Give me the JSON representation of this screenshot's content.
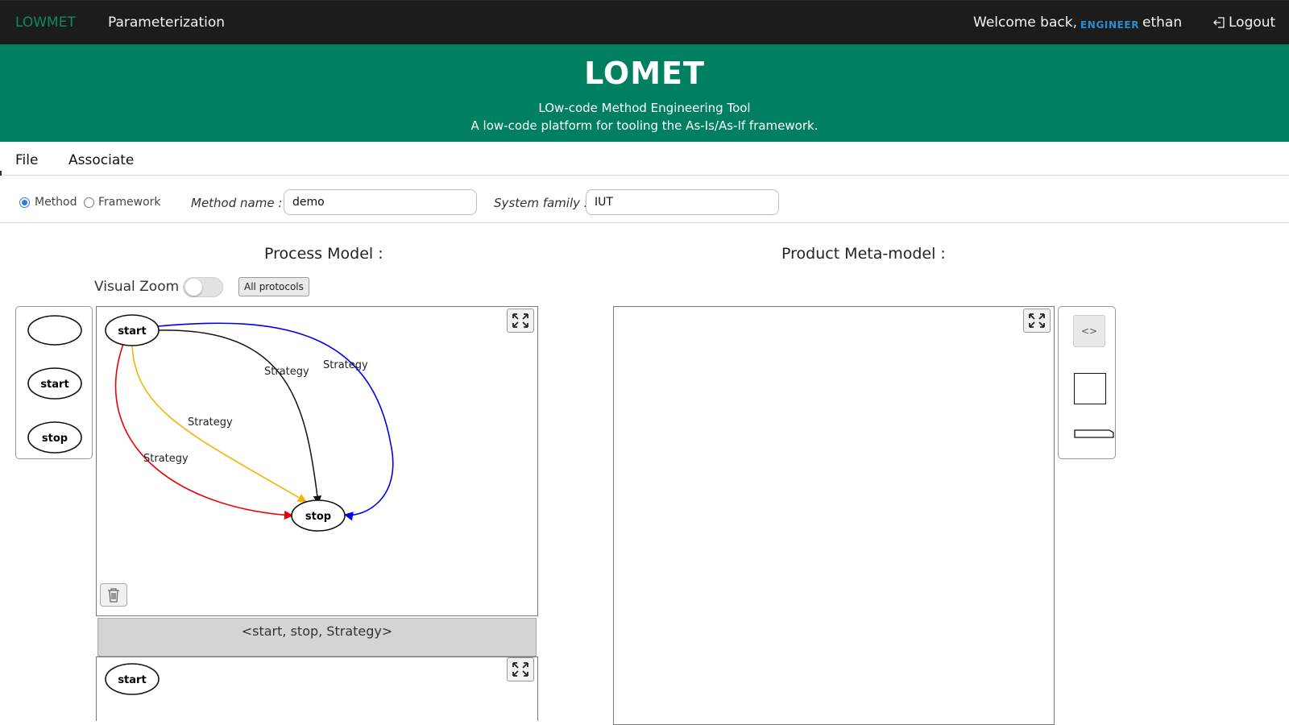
{
  "nav": {
    "brand": "LOWMET",
    "link": "Parameterization",
    "welcome": "Welcome back,",
    "role": "ENGINEER",
    "username": "ethan",
    "logout": "Logout"
  },
  "banner": {
    "title": "LOMET",
    "subtitle1": "LOw-code Method Engineering Tool",
    "subtitle2": "A low-code platform for tooling the As-Is/As-If framework."
  },
  "menu": {
    "file": "File",
    "associate": "Associate"
  },
  "form": {
    "mode_options": [
      "Method",
      "Framework"
    ],
    "selected_mode": "Method",
    "method_name_label": "Method name :",
    "method_name_value": "demo",
    "system_family_label": "System family :",
    "system_family_value": "IUT"
  },
  "process": {
    "title": "Process Model :",
    "zoom_label": "Visual Zoom",
    "zoom_on": false,
    "protocols_button": "All protocols",
    "palette": [
      "",
      "start",
      "stop"
    ],
    "nodes": {
      "start": "start",
      "stop": "stop"
    },
    "edges": [
      {
        "label": "Strategy",
        "color": "#111111"
      },
      {
        "label": "Strategy",
        "color": "#0000ee"
      },
      {
        "label": "Strategy",
        "color": "#f5b400"
      },
      {
        "label": "Strategy",
        "color": "#ee0000"
      }
    ],
    "protocol_title": "<start, stop, Strategy>",
    "protocol_node": "start"
  },
  "product": {
    "title": "Product Meta-model :",
    "code_button": "<>"
  },
  "colors": {
    "topbar": "#1c1c1c",
    "banner": "#008060",
    "brand": "#0f8a5c",
    "role": "#2e8bd0"
  }
}
